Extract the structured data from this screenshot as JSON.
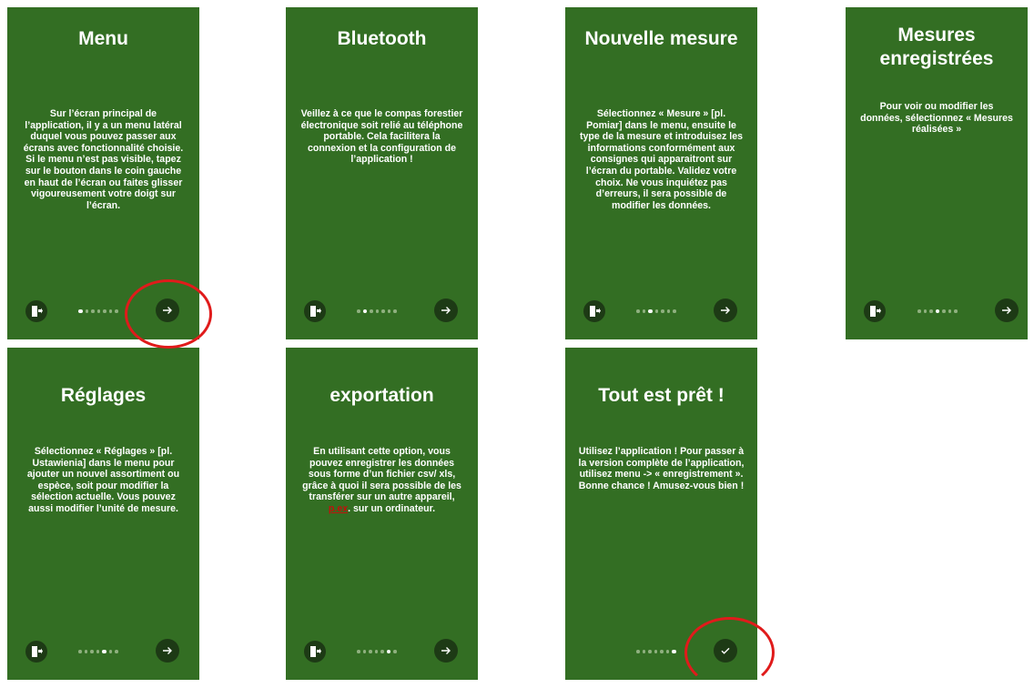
{
  "screens": [
    {
      "title": "Menu",
      "text": "Sur l’écran principal de l’application, il y a un menu latéral duquel vous pouvez passer aux écrans avec fonctionnalité choisie. Si le menu n’est pas visible, tapez sur le bouton dans le coin gauche en haut de l’écran ou faites glisser vigoureusement votre doigt sur l’écran."
    },
    {
      "title": "Bluetooth",
      "text": "Veillez à ce que le compas forestier électronique soit relié au téléphone portable. Cela facilitera la connexion et la configuration de l’application !"
    },
    {
      "title": "Nouvelle mesure",
      "text": "Sélectionnez « Mesure » [pl. Pomiar] dans le menu, ensuite le type de la mesure et introduisez les informations conformément aux consignes qui apparaitront sur l’écran du portable. Validez votre choix. Ne vous inquiétez pas d’erreurs, il sera possible de modifier les données."
    },
    {
      "title": "Mesures enregistrées",
      "text": "Pour voir ou modifier les données, sélectionnez « Mesures réalisées »"
    },
    {
      "title": "Réglages",
      "text": "Sélectionnez « Réglages » [pl. Ustawienia] dans le menu pour ajouter un nouvel assortiment ou espèce, soit pour modifier la sélection actuelle. Vous pouvez aussi modifier l’unité de mesure."
    },
    {
      "title": "exportation",
      "text_before": "En utilisant cette option, vous pouvez enregistrer les données sous forme d’un fichier csv/ xls, grâce à quoi il sera possible de les transférer sur un autre appareil, ",
      "link": "p.ex",
      "text_after": ". sur un ordinateur."
    },
    {
      "title": "Tout est prêt !",
      "text": "Utilisez l’application ! Pour passer à la version complète de l’application, utilisez menu -> « enregistrement ». Bonne chance ! Amusez-vous bien !"
    }
  ],
  "pagination": {
    "total": 7,
    "current": [
      1,
      2,
      3,
      4,
      5,
      6,
      7
    ]
  },
  "icons": {
    "exit": "exit-door-icon",
    "next": "arrow-right-icon",
    "done": "checkmark-icon"
  },
  "colors": {
    "screen_bg": "#336e23",
    "button_bg": "#1d3a15",
    "highlight": "#e01b1b",
    "link": "#c0120c"
  }
}
